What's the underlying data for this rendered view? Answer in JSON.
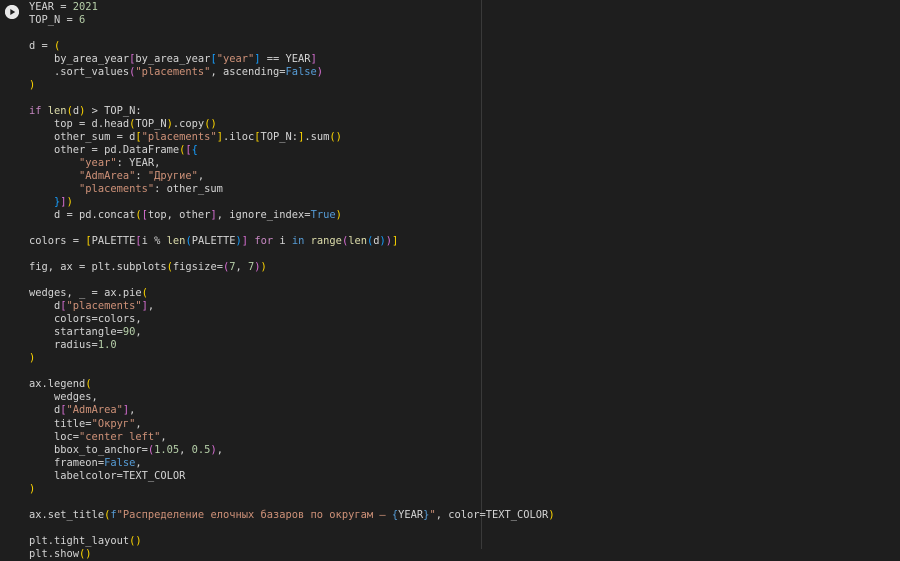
{
  "cell": {
    "run_button": "run-cell",
    "lines": [
      [
        [
          "t",
          "YEAR = "
        ],
        [
          "n",
          "2021"
        ]
      ],
      [
        [
          "t",
          "TOP_N = "
        ],
        [
          "n",
          "6"
        ]
      ],
      [],
      [
        [
          "t",
          "d = "
        ],
        [
          "p1",
          "("
        ]
      ],
      [
        [
          "t",
          "    by_area_year"
        ],
        [
          "p2",
          "["
        ],
        [
          "t",
          "by_area_year"
        ],
        [
          "p3",
          "["
        ],
        [
          "s",
          "\"year\""
        ],
        [
          "p3",
          "]"
        ],
        [
          "t",
          " == YEAR"
        ],
        [
          "p2",
          "]"
        ]
      ],
      [
        [
          "t",
          "    .sort_values"
        ],
        [
          "p2",
          "("
        ],
        [
          "s",
          "\"placements\""
        ],
        [
          "t",
          ", ascending="
        ],
        [
          "b",
          "False"
        ],
        [
          "p2",
          ")"
        ]
      ],
      [
        [
          "p1",
          ")"
        ]
      ],
      [],
      [
        [
          "k",
          "if "
        ],
        [
          "f",
          "len"
        ],
        [
          "p1",
          "("
        ],
        [
          "t",
          "d"
        ],
        [
          "p1",
          ")"
        ],
        [
          "t",
          " > TOP_N:"
        ]
      ],
      [
        [
          "t",
          "    top = d.head"
        ],
        [
          "p1",
          "("
        ],
        [
          "t",
          "TOP_N"
        ],
        [
          "p1",
          ")"
        ],
        [
          "t",
          ".copy"
        ],
        [
          "p1",
          "()"
        ]
      ],
      [
        [
          "t",
          "    other_sum = d"
        ],
        [
          "p1",
          "["
        ],
        [
          "s",
          "\"placements\""
        ],
        [
          "p1",
          "]"
        ],
        [
          "t",
          ".iloc"
        ],
        [
          "p1",
          "["
        ],
        [
          "t",
          "TOP_N:"
        ],
        [
          "p1",
          "]"
        ],
        [
          "t",
          ".sum"
        ],
        [
          "p1",
          "()"
        ]
      ],
      [
        [
          "t",
          "    other = pd.DataFrame"
        ],
        [
          "p1",
          "("
        ],
        [
          "p2",
          "["
        ],
        [
          "p3",
          "{"
        ]
      ],
      [
        [
          "t",
          "        "
        ],
        [
          "s",
          "\"year\""
        ],
        [
          "t",
          ": YEAR,"
        ]
      ],
      [
        [
          "t",
          "        "
        ],
        [
          "s",
          "\"AdmArea\""
        ],
        [
          "t",
          ": "
        ],
        [
          "s",
          "\"Другие\""
        ],
        [
          "t",
          ","
        ]
      ],
      [
        [
          "t",
          "        "
        ],
        [
          "s",
          "\"placements\""
        ],
        [
          "t",
          ": other_sum"
        ]
      ],
      [
        [
          "t",
          "    "
        ],
        [
          "p3",
          "}"
        ],
        [
          "p2",
          "]"
        ],
        [
          "p1",
          ")"
        ]
      ],
      [
        [
          "t",
          "    d = pd.concat"
        ],
        [
          "p1",
          "("
        ],
        [
          "p2",
          "["
        ],
        [
          "t",
          "top, other"
        ],
        [
          "p2",
          "]"
        ],
        [
          "t",
          ", ignore_index="
        ],
        [
          "b",
          "True"
        ],
        [
          "p1",
          ")"
        ]
      ],
      [],
      [
        [
          "t",
          "colors = "
        ],
        [
          "p1",
          "["
        ],
        [
          "t",
          "PALETTE"
        ],
        [
          "p2",
          "["
        ],
        [
          "t",
          "i % "
        ],
        [
          "f",
          "len"
        ],
        [
          "p3",
          "("
        ],
        [
          "t",
          "PALETTE"
        ],
        [
          "p3",
          ")"
        ],
        [
          "p2",
          "]"
        ],
        [
          "t",
          " "
        ],
        [
          "k",
          "for"
        ],
        [
          "t",
          " i "
        ],
        [
          "b",
          "in"
        ],
        [
          "t",
          " "
        ],
        [
          "f",
          "range"
        ],
        [
          "p2",
          "("
        ],
        [
          "f",
          "len"
        ],
        [
          "p3",
          "("
        ],
        [
          "t",
          "d"
        ],
        [
          "p3",
          ")"
        ],
        [
          "p2",
          ")"
        ],
        [
          "p1",
          "]"
        ]
      ],
      [],
      [
        [
          "t",
          "fig, ax = plt.subplots"
        ],
        [
          "p1",
          "("
        ],
        [
          "t",
          "figsize="
        ],
        [
          "p2",
          "("
        ],
        [
          "n",
          "7"
        ],
        [
          "t",
          ", "
        ],
        [
          "n",
          "7"
        ],
        [
          "p2",
          ")"
        ],
        [
          "p1",
          ")"
        ]
      ],
      [],
      [
        [
          "t",
          "wedges, _ = ax.pie"
        ],
        [
          "p1",
          "("
        ]
      ],
      [
        [
          "t",
          "    d"
        ],
        [
          "p2",
          "["
        ],
        [
          "s",
          "\"placements\""
        ],
        [
          "p2",
          "]"
        ],
        [
          "t",
          ","
        ]
      ],
      [
        [
          "t",
          "    colors=colors,"
        ]
      ],
      [
        [
          "t",
          "    startangle="
        ],
        [
          "n",
          "90"
        ],
        [
          "t",
          ","
        ]
      ],
      [
        [
          "t",
          "    radius="
        ],
        [
          "n",
          "1.0"
        ]
      ],
      [
        [
          "p1",
          ")"
        ]
      ],
      [],
      [
        [
          "t",
          "ax.legend"
        ],
        [
          "p1",
          "("
        ]
      ],
      [
        [
          "t",
          "    wedges,"
        ]
      ],
      [
        [
          "t",
          "    d"
        ],
        [
          "p2",
          "["
        ],
        [
          "s",
          "\"AdmArea\""
        ],
        [
          "p2",
          "]"
        ],
        [
          "t",
          ","
        ]
      ],
      [
        [
          "t",
          "    title="
        ],
        [
          "s",
          "\"Округ\""
        ],
        [
          "t",
          ","
        ]
      ],
      [
        [
          "t",
          "    loc="
        ],
        [
          "s",
          "\"center left\""
        ],
        [
          "t",
          ","
        ]
      ],
      [
        [
          "t",
          "    bbox_to_anchor="
        ],
        [
          "p2",
          "("
        ],
        [
          "n",
          "1.05"
        ],
        [
          "t",
          ", "
        ],
        [
          "n",
          "0.5"
        ],
        [
          "p2",
          ")"
        ],
        [
          "t",
          ","
        ]
      ],
      [
        [
          "t",
          "    frameon="
        ],
        [
          "b",
          "False"
        ],
        [
          "t",
          ","
        ]
      ],
      [
        [
          "t",
          "    labelcolor=TEXT_COLOR"
        ]
      ],
      [
        [
          "p1",
          ")"
        ]
      ],
      [],
      [
        [
          "t",
          "ax.set_title"
        ],
        [
          "p1",
          "("
        ],
        [
          "b",
          "f"
        ],
        [
          "s",
          "\"Распределение елочных базаров по округам — "
        ],
        [
          "b",
          "{"
        ],
        [
          "t",
          "YEAR"
        ],
        [
          "b",
          "}"
        ],
        [
          "s",
          "\""
        ],
        [
          "t",
          ", color=TEXT_COLOR"
        ],
        [
          "p1",
          ")"
        ]
      ],
      [],
      [
        [
          "t",
          "plt.tight_layout"
        ],
        [
          "p1",
          "()"
        ]
      ],
      [
        [
          "t",
          "plt.show"
        ],
        [
          "p1",
          "()"
        ]
      ]
    ]
  }
}
